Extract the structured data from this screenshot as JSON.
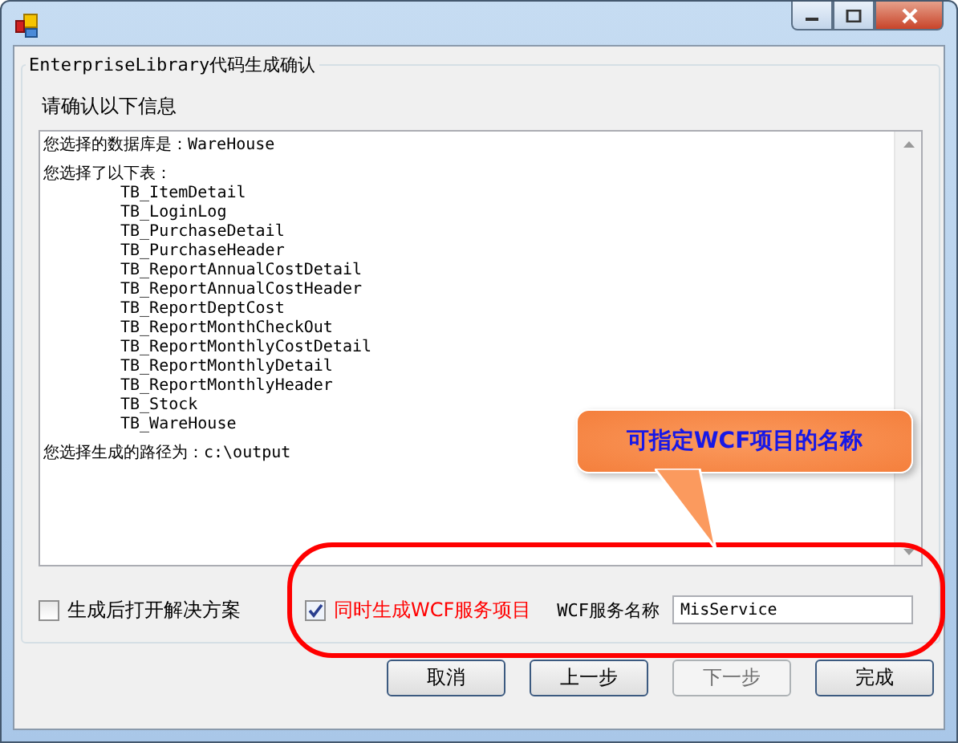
{
  "window": {
    "title_buttons": [
      {
        "kind": "minimize"
      },
      {
        "kind": "maximize"
      },
      {
        "kind": "close"
      }
    ]
  },
  "group": {
    "legend": "EnterpriseLibrary代码生成确认"
  },
  "prompt": "请确认以下信息",
  "summary": {
    "database_line": "您选择的数据库是：WareHouse",
    "tables_heading": "您选择了以下表：",
    "tables": [
      "TB_ItemDetail",
      "TB_LoginLog",
      "TB_PurchaseDetail",
      "TB_PurchaseHeader",
      "TB_ReportAnnualCostDetail",
      "TB_ReportAnnualCostHeader",
      "TB_ReportDeptCost",
      "TB_ReportMonthCheckOut",
      "TB_ReportMonthlyCostDetail",
      "TB_ReportMonthlyDetail",
      "TB_ReportMonthlyHeader",
      "TB_Stock",
      "TB_WareHouse"
    ],
    "path_line": "您选择生成的路径为：c:\\output"
  },
  "options": [
    {
      "label": "生成后打开解决方案",
      "checked": false,
      "highlighted": false
    },
    {
      "label": "同时生成WCF服务项目",
      "checked": true,
      "highlighted": true
    }
  ],
  "service_name": {
    "label": "WCF服务名称",
    "value": "MisService"
  },
  "callout": {
    "text": "可指定WCF项目的名称"
  },
  "buttons": [
    {
      "label": "取消",
      "disabled": false
    },
    {
      "label": "上一步",
      "disabled": false
    },
    {
      "label": "下一步",
      "disabled": true
    },
    {
      "label": "完成",
      "disabled": false
    }
  ]
}
